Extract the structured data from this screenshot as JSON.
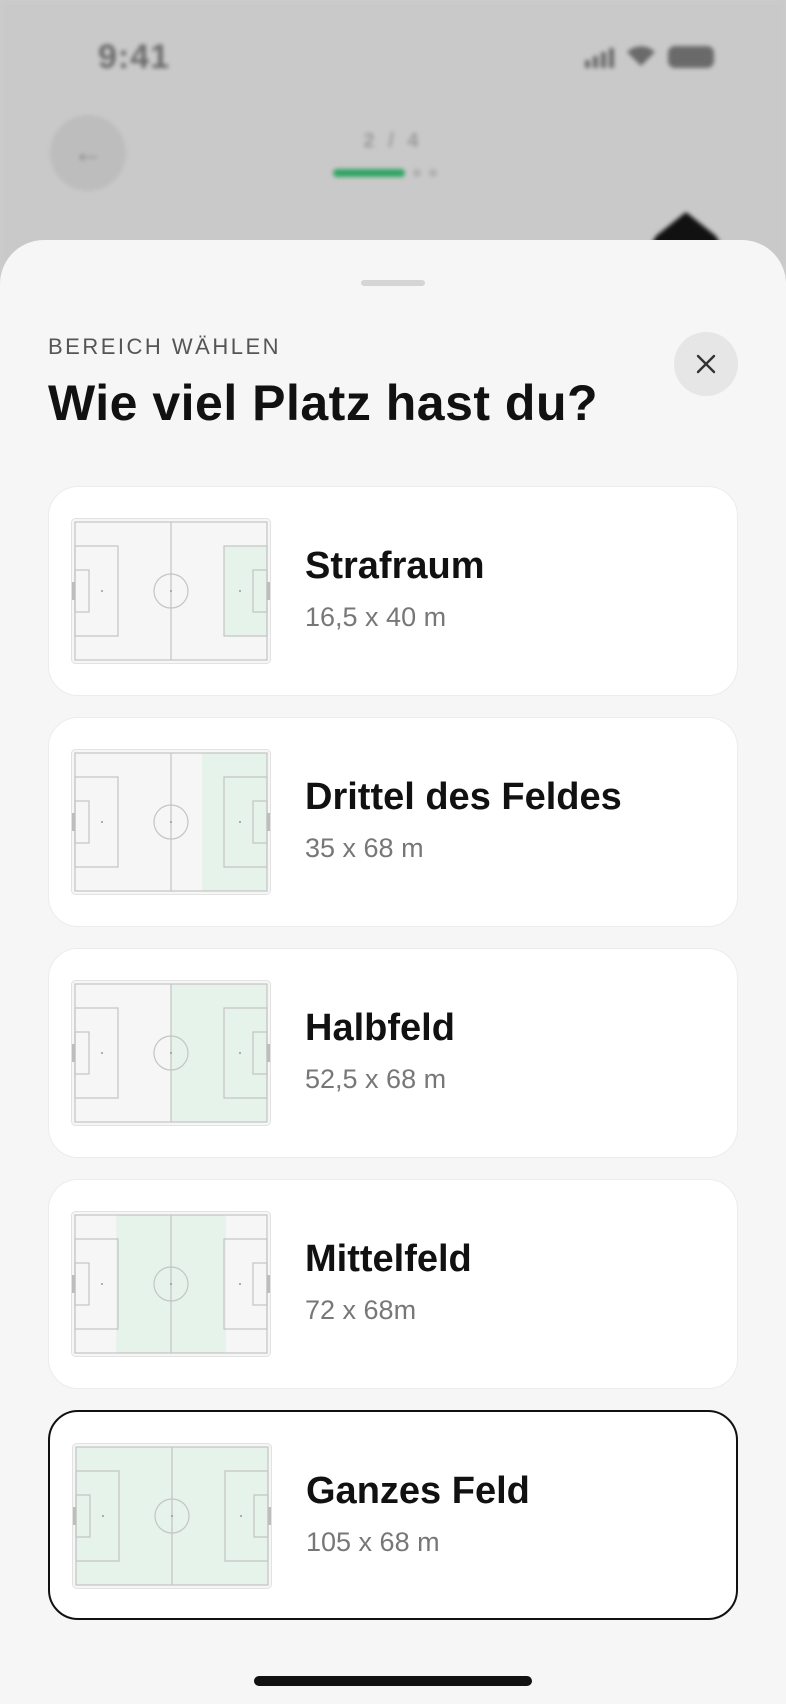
{
  "status_bar": {
    "time": "9:41"
  },
  "header": {
    "back_icon": "arrow-left-icon",
    "step_label": "2 / 4"
  },
  "sheet": {
    "eyebrow": "BEREICH WÄHLEN",
    "title": "Wie viel Platz hast du?",
    "close_icon": "close-icon"
  },
  "options": [
    {
      "name": "Strafraum",
      "size": "16,5 x 40 m",
      "highlight": "penalty-right",
      "selected": false
    },
    {
      "name": "Drittel des Feldes",
      "size": "35 x 68 m",
      "highlight": "third-right",
      "selected": false
    },
    {
      "name": "Halbfeld",
      "size": "52,5 x 68 m",
      "highlight": "half-right",
      "selected": false
    },
    {
      "name": "Mittelfeld",
      "size": "72 x 68m",
      "highlight": "middle",
      "selected": false
    },
    {
      "name": "Ganzes Feld",
      "size": "105 x 68 m",
      "highlight": "full",
      "selected": true
    }
  ],
  "colors": {
    "accent": "#2fa463",
    "highlight_fill": "#e6f3ea",
    "pitch_line": "#c4c4c4"
  }
}
